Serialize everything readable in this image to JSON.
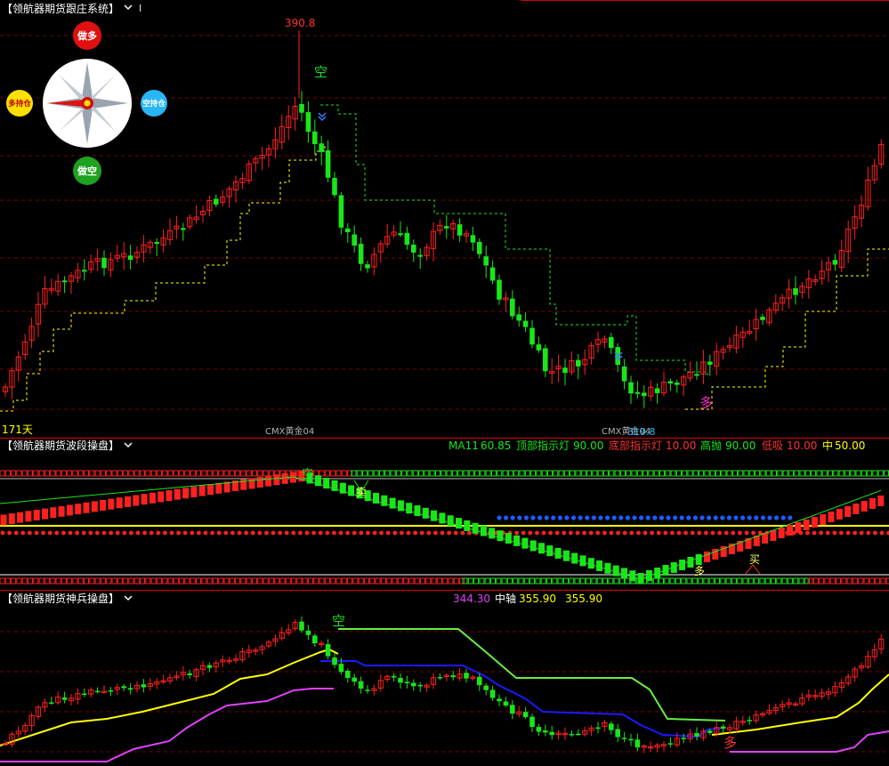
{
  "colors": {
    "bg": "#000000",
    "up": "#ff2020",
    "down": "#19e619",
    "yellow": "#ffff00",
    "magenta": "#e040fb",
    "blue": "#1a1aff",
    "cyan": "#00bcd4",
    "dashed_grid": "#8b0000"
  },
  "panel1": {
    "title": "【领航器期货跟庄系统】",
    "title_icon": "chevron-down-icon",
    "indicator_marker": "I",
    "high_label": "390.8",
    "sell_signal": "空",
    "buy_signal": "多",
    "days_label": "171天",
    "contract_left": "CMX黄金04",
    "contract_right": "CMX黄金04",
    "low_label": "319.8",
    "compass": {
      "top_label": "做多",
      "left_label": "多持仓",
      "right_label": "空持仓",
      "bottom_label": "做空"
    }
  },
  "panel2": {
    "title": "【领航器期货波段操盘】",
    "title_icon": "chevron-down-icon",
    "ma_label": "MA11",
    "ma_value": "60.85",
    "top_light_label": "顶部指示灯",
    "top_light_value": "90.00",
    "bottom_light_label": "底部指示灯",
    "bottom_light_value": "10.00",
    "high_throw_label": "高抛",
    "high_throw_value": "90.00",
    "low_buy_label": "低吸",
    "low_buy_value": "10.00",
    "mid_label": "中",
    "mid_value": "50.00",
    "sell_signal": "空",
    "sell_mark": "卖",
    "buy_signal": "多",
    "buy_mark": "买"
  },
  "panel3": {
    "title": "【领航器期货神兵操盘】",
    "title_icon": "chevron-down-icon",
    "lower_value": "344.30",
    "axis_label": "中轴",
    "axis_value": "355.90",
    "upper_value": "355.90",
    "sell_signal": "空",
    "buy_signal": "多"
  },
  "chart_data": {
    "type": "candlestick",
    "high_marker": 390.8,
    "low_marker": 319.8,
    "series": [
      {
        "name": "MA11",
        "value": 60.85
      },
      {
        "name": "中轴",
        "value": 355.9
      }
    ]
  }
}
